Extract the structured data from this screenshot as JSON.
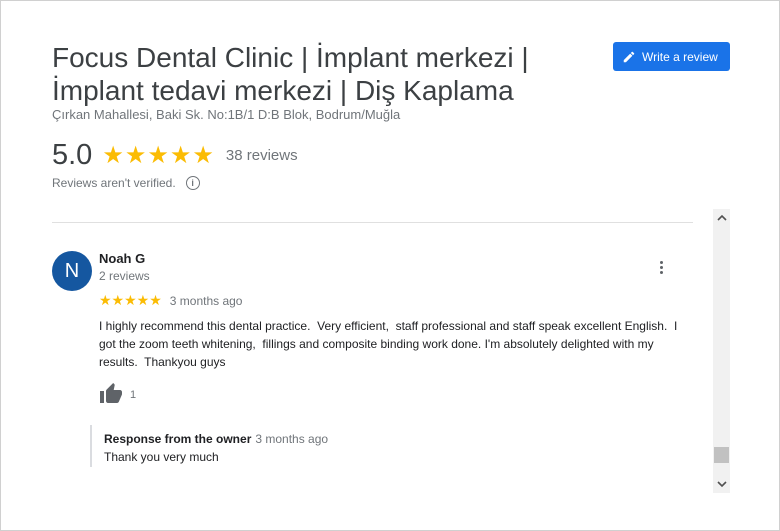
{
  "place": {
    "title": "Focus Dental Clinic | İmplant merkezi | İmplant tedavi merkezi | Diş Kaplama",
    "address": "Çırkan Mahallesi, Baki Sk. No:1B/1 D:B Blok, Bodrum/Muğla",
    "write_review_label": "Write a review",
    "rating": "5.0",
    "stars": "★★★★★",
    "review_count": "38 reviews",
    "verification_note": "Reviews aren't verified.",
    "info_glyph": "i"
  },
  "review": {
    "avatar_letter": "N",
    "reviewer_name": "Noah G",
    "reviewer_review_count": "2 reviews",
    "stars": "★★★★★",
    "time": "3 months ago",
    "text": "I highly recommend this dental practice.  Very efficient,  staff professional and staff speak excellent English.  I got the zoom teeth whitening,  fillings and composite binding work done. I'm absolutely delighted with my results.  Thankyou guys",
    "like_count": "1",
    "owner_response": {
      "label": "Response from the owner",
      "time": "3 months ago",
      "text": "Thank you very much"
    }
  },
  "colors": {
    "accent": "#1a73e8",
    "star": "#fbbc04",
    "avatar": "#1557a0"
  },
  "icons": {
    "write_review": "pencil-icon",
    "more": "more-vertical-icon",
    "like": "thumbs-up-icon",
    "info": "info-icon",
    "scroll_up": "chevron-up-icon",
    "scroll_down": "chevron-down-icon"
  }
}
